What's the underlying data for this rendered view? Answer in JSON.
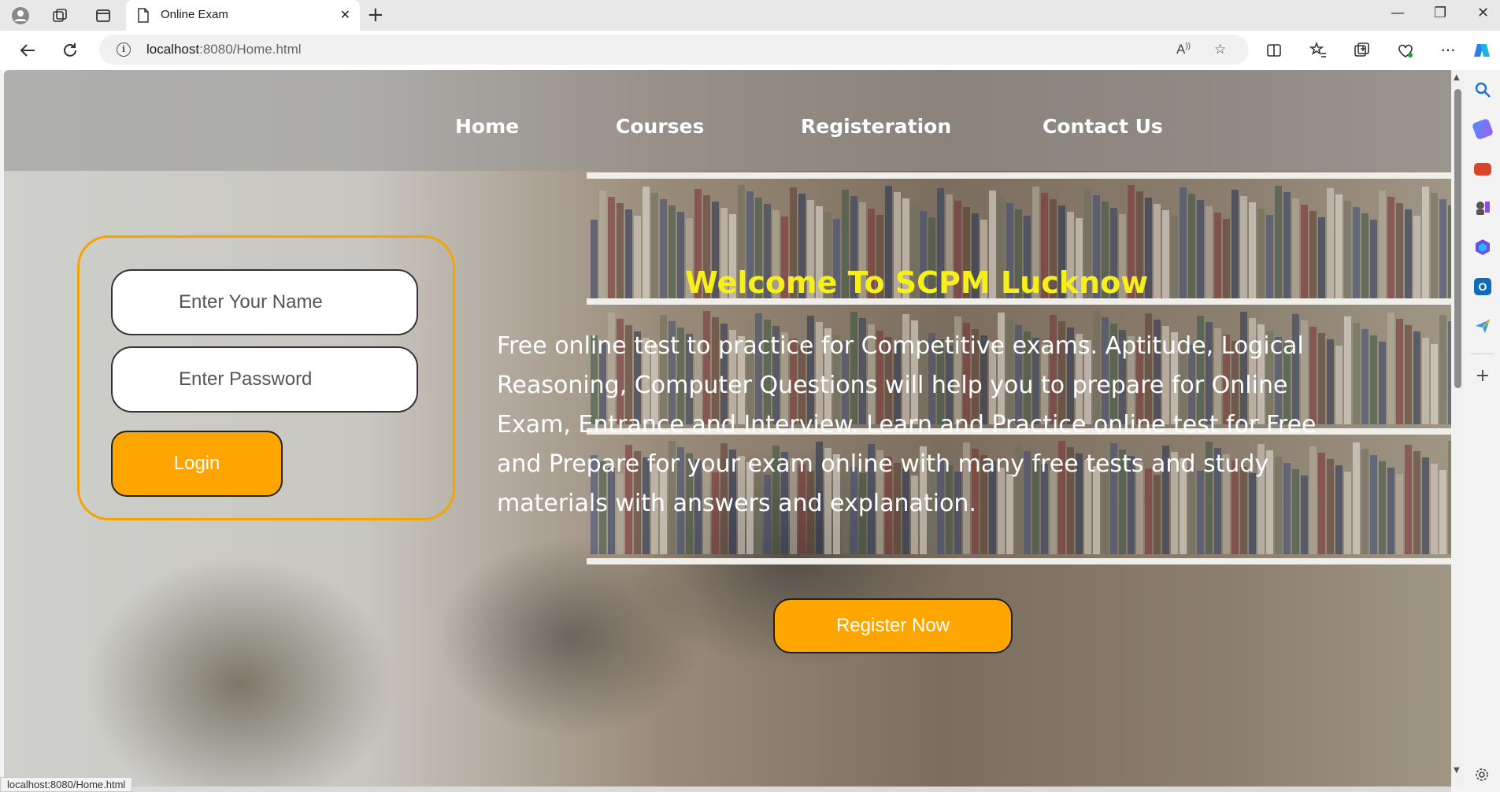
{
  "browser": {
    "tab_title": "Online Exam",
    "url_host": "localhost",
    "url_path": ":8080/Home.html",
    "status_url": "localhost:8080/Home.html"
  },
  "page": {
    "menu": [
      "Home",
      "Courses",
      "Registeration",
      "Contact Us"
    ],
    "login": {
      "name_placeholder": "Enter Your Name",
      "password_placeholder": "Enter Password",
      "button": "Login"
    },
    "welcome_title": "Welcome To SCPM Lucknow",
    "description": "Free online test to practice for Competitive exams. Aptitude, Logical Reasoning, Computer Questions will help you to prepare for Online Exam, Entrance and Interview. Learn and Practice online test for Free and Prepare for your exam online with many free tests and study materials with answers and explanation.",
    "register_button": "Register Now"
  },
  "colors": {
    "accent": "#ffa500",
    "title": "#f7ef1a",
    "login_border": "#f5a300"
  }
}
